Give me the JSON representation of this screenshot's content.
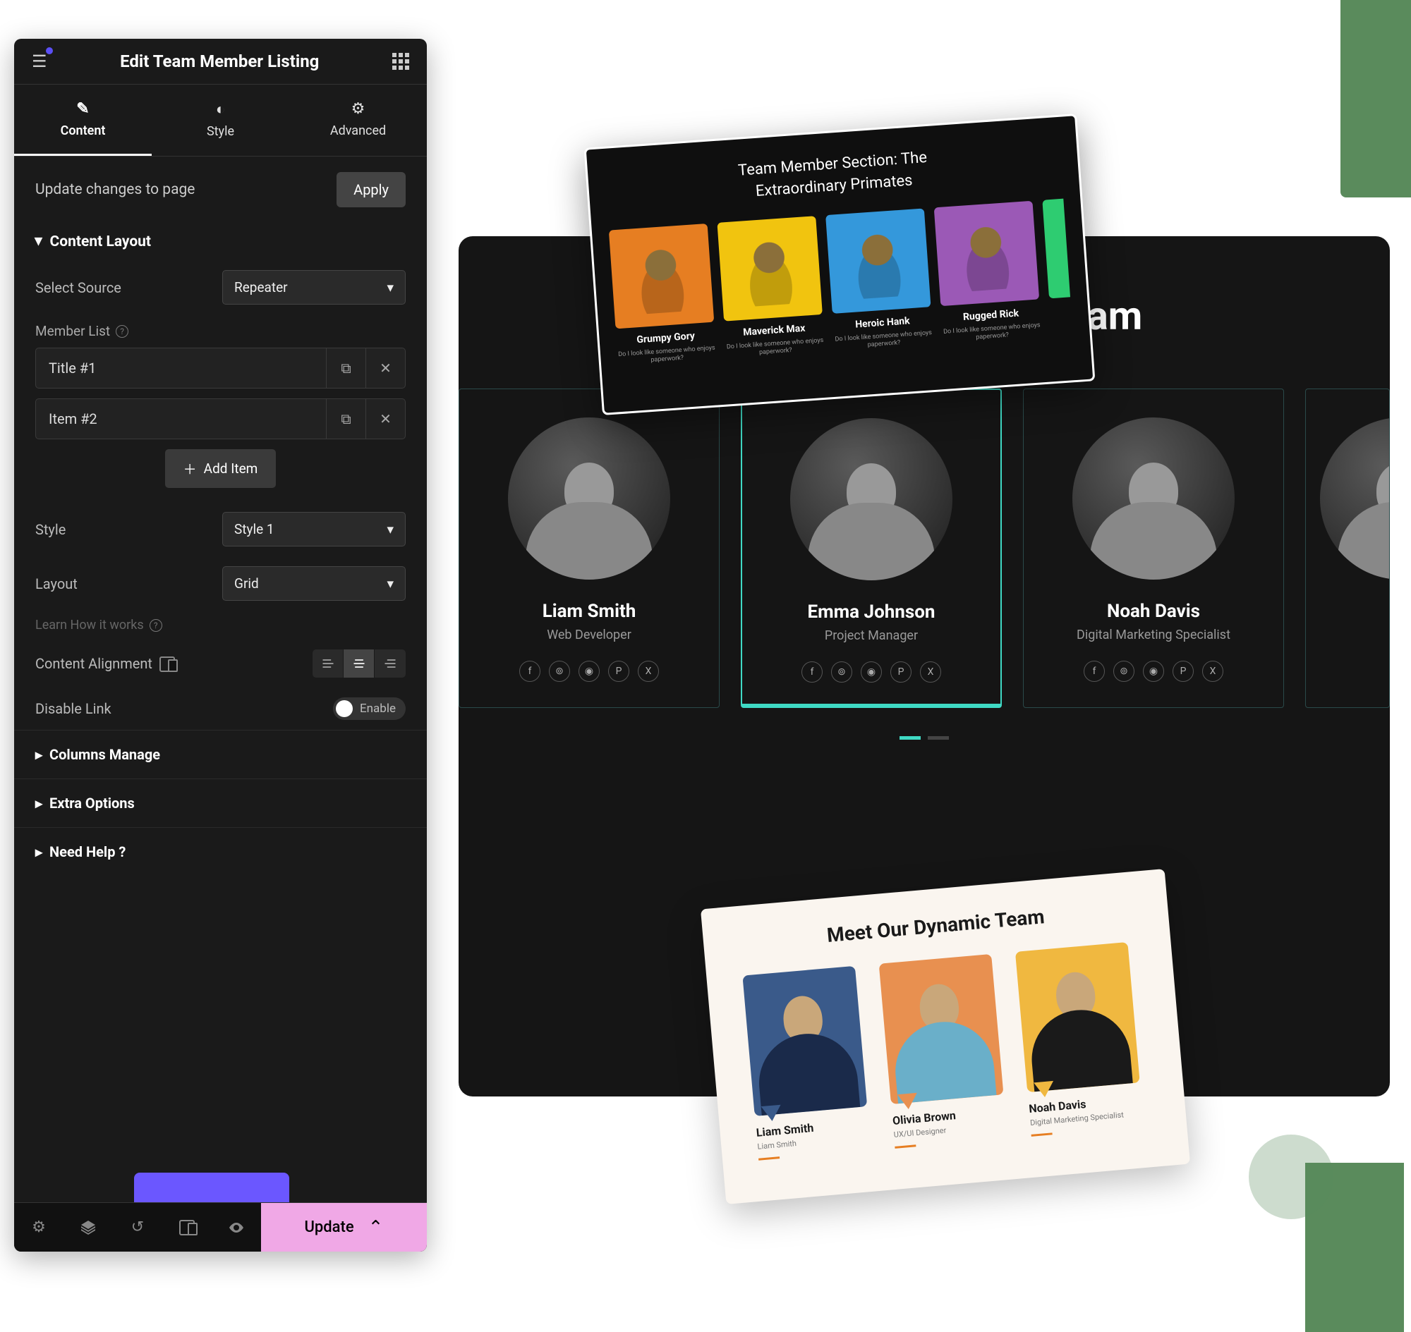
{
  "sidebar": {
    "title": "Edit Team Member Listing",
    "tabs": {
      "content": "Content",
      "style": "Style",
      "advanced": "Advanced"
    },
    "apply_row": {
      "text": "Update changes to page",
      "button": "Apply"
    },
    "content_layout": {
      "title": "Content Layout",
      "select_source": {
        "label": "Select Source",
        "value": "Repeater"
      },
      "member_list": {
        "label": "Member List",
        "items": [
          "Title #1",
          "Item #2"
        ],
        "add": "Add Item"
      },
      "style_sel": {
        "label": "Style",
        "value": "Style 1"
      },
      "layout_sel": {
        "label": "Layout",
        "value": "Grid"
      },
      "learn": "Learn How it works",
      "align": {
        "label": "Content Alignment"
      },
      "disable_link": {
        "label": "Disable Link",
        "toggle": "Enable"
      }
    },
    "collapsed": [
      "Columns Manage",
      "Extra Options",
      "Need Help ?"
    ],
    "footer": {
      "update": "Update"
    }
  },
  "preview": {
    "title": "Meet Our Dynamic Team",
    "cards": [
      {
        "name": "Liam Smith",
        "role": "Web Developer"
      },
      {
        "name": "Emma Johnson",
        "role": "Project Manager"
      },
      {
        "name": "Noah Davis",
        "role": "Digital Marketing Specialist"
      }
    ]
  },
  "tilt_top": {
    "title_l1": "Team Member Section: The",
    "title_l2": "Extraordinary Primates",
    "cards": [
      {
        "name": "Grumpy Gory",
        "desc": "Do I look like someone who enjoys paperwork?",
        "bg": "#e67e22"
      },
      {
        "name": "Maverick Max",
        "desc": "Do I look like someone who enjoys paperwork?",
        "bg": "#f1c40f"
      },
      {
        "name": "Heroic Hank",
        "desc": "Do I look like someone who enjoys paperwork?",
        "bg": "#3498db"
      },
      {
        "name": "Rugged Rick",
        "desc": "Do I look like someone who enjoys paperwork?",
        "bg": "#9b59b6"
      }
    ],
    "partial_bg": "#2ecc71"
  },
  "tilt_bot": {
    "title": "Meet Our Dynamic Team",
    "cards": [
      {
        "name": "Liam Smith",
        "role": "Liam Smith"
      },
      {
        "name": "Olivia Brown",
        "role": "UX/UI Designer"
      },
      {
        "name": "Noah Davis",
        "role": "Digital Marketing Specialist"
      }
    ]
  },
  "social_icons": [
    "f",
    "⊚",
    "◉",
    "P",
    "X"
  ],
  "colors": {
    "sidebar_bg": "#1a1a1a",
    "accent_teal": "#3fd9c4",
    "accent_purple": "#6b57ff",
    "update_pink": "#f0a8e6",
    "green_deco": "#5a8b5c"
  }
}
